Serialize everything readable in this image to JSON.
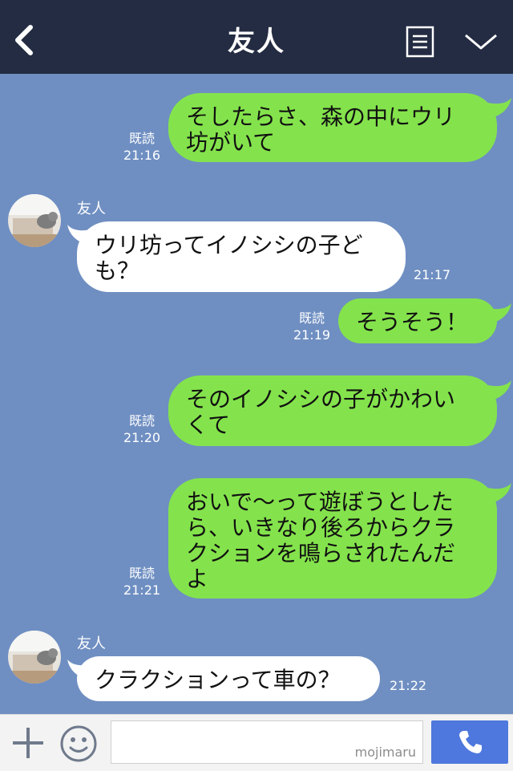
{
  "header": {
    "title": "友人"
  },
  "messages": [
    {
      "dir": "sent",
      "text": "そしたらさ、森の中にウリ\n坊がいて",
      "read": "既読",
      "time": "21:16"
    },
    {
      "dir": "recv",
      "sender": "友人",
      "text": "ウリ坊ってイノシシの子ど\nも？",
      "time": "21:17"
    },
    {
      "dir": "sent",
      "text": "そうそう！",
      "read": "既読",
      "time": "21:19"
    },
    {
      "dir": "sent",
      "text": "そのイノシシの子がかわい\nくて",
      "read": "既読",
      "time": "21:20"
    },
    {
      "dir": "sent",
      "text": "おいで〜って遊ぼうとした\nら、いきなり後ろからクラ\nクションを鳴らされたんだ\nよ",
      "read": "既読",
      "time": "21:21"
    },
    {
      "dir": "recv",
      "sender": "友人",
      "text": "クラクションって車の？",
      "time": "21:22"
    }
  ],
  "footer": {
    "watermark": "mojimaru"
  },
  "colors": {
    "header": "#232c42",
    "background": "#6f8fc2",
    "sent_bubble": "#84e34c",
    "call_button": "#4e78dd"
  }
}
